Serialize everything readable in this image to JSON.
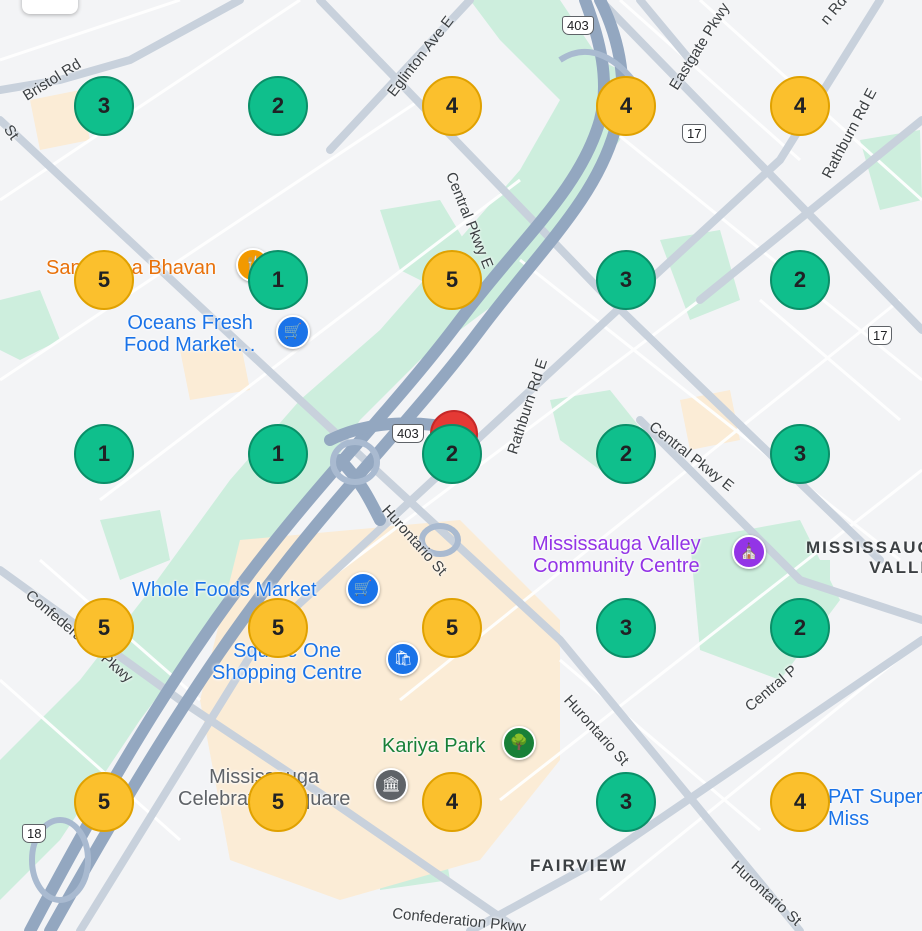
{
  "map": {
    "colors": {
      "land": "#f3f4f6",
      "park": "#cdeedd",
      "commercial": "#fbecd6",
      "highway": "#93a7c0",
      "road": "#ffffff",
      "low_marker": "#0fbf8c",
      "high_marker": "#fbc02d",
      "pin": "#e53935"
    },
    "markers": [
      {
        "value": "3",
        "level": "low"
      },
      {
        "value": "2",
        "level": "low"
      },
      {
        "value": "4",
        "level": "high"
      },
      {
        "value": "4",
        "level": "high"
      },
      {
        "value": "4",
        "level": "high"
      },
      {
        "value": "5",
        "level": "high"
      },
      {
        "value": "1",
        "level": "low"
      },
      {
        "value": "5",
        "level": "high"
      },
      {
        "value": "3",
        "level": "low"
      },
      {
        "value": "2",
        "level": "low"
      },
      {
        "value": "1",
        "level": "low"
      },
      {
        "value": "1",
        "level": "low"
      },
      {
        "value": "2",
        "level": "low"
      },
      {
        "value": "2",
        "level": "low"
      },
      {
        "value": "3",
        "level": "low"
      },
      {
        "value": "5",
        "level": "high"
      },
      {
        "value": "5",
        "level": "high"
      },
      {
        "value": "5",
        "level": "high"
      },
      {
        "value": "3",
        "level": "low"
      },
      {
        "value": "2",
        "level": "low"
      },
      {
        "value": "5",
        "level": "high"
      },
      {
        "value": "5",
        "level": "high"
      },
      {
        "value": "4",
        "level": "high"
      },
      {
        "value": "3",
        "level": "low"
      },
      {
        "value": "4",
        "level": "high"
      }
    ],
    "pois": {
      "sangeetha": "Sangeetha Bhavan",
      "oceans": "Oceans Fresh\nFood Market…",
      "whole_foods": "Whole Foods Market",
      "square_one": "Square One\nShopping Centre",
      "valley_cc": "Mississauga Valley\nCommunity Centre",
      "kariya": "Kariya Park",
      "celebration": "Mississauga\nCelebration Square",
      "pat": "PAT Super\nMiss"
    },
    "streets": {
      "bristol": "Bristol Rd",
      "eglinton": "Eglinton Ave E",
      "eastgate": "Eastgate Pkwy",
      "rathburn_ne": "Rathburn Rd E",
      "rathburn_mid": "Rathburn Rd E",
      "central_n": "Central Pkwy E",
      "central_e": "Central Pkwy E",
      "central_se": "Central P",
      "hurontario_n": "Hurontario St",
      "hurontario_s": "Hurontario St",
      "hurontario_se": "Hurontario St",
      "confed_w": "Confederation Pkwy",
      "confed_s": "Confederation Pkwy",
      "top_rd": "n Rd",
      "st_left": "St"
    },
    "districts": {
      "mississauga_valley": "MISSISSAUGA\nVALLEY",
      "fairview": "FAIRVIEW"
    },
    "shields": {
      "hwy403_top": "403",
      "hwy403_mid": "403",
      "r17_top": "17",
      "r17_right": "17",
      "r18": "18"
    }
  }
}
